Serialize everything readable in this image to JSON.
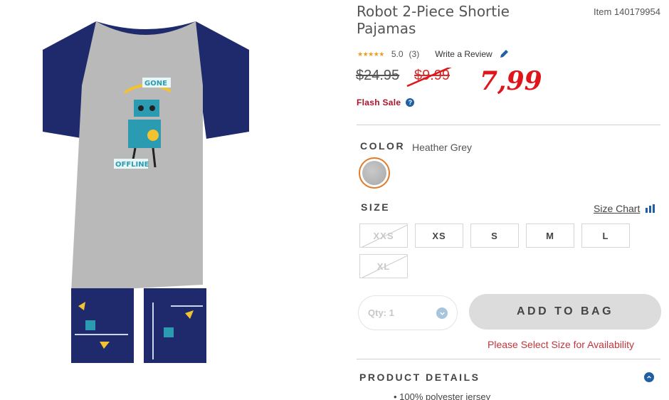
{
  "product": {
    "title": "Robot 2-Piece Shortie Pajamas",
    "item_number": "Item 140179954",
    "image_texts": [
      "GONE",
      "OFFLINE"
    ]
  },
  "rating": {
    "stars_glyph": "★★★★★",
    "value": "5.0",
    "count": "(3)",
    "write_review_label": "Write a Review"
  },
  "price": {
    "original": "$24.95",
    "sale": "$9.99",
    "handwritten_price": "7,99",
    "flash_sale_label": "Flash Sale"
  },
  "color": {
    "label": "COLOR",
    "value": "Heather Grey"
  },
  "size": {
    "label": "SIZE",
    "size_chart_label": "Size Chart",
    "options": [
      {
        "label": "XXS",
        "available": false
      },
      {
        "label": "XS",
        "available": true
      },
      {
        "label": "S",
        "available": true
      },
      {
        "label": "M",
        "available": true
      },
      {
        "label": "L",
        "available": true
      },
      {
        "label": "XL",
        "available": false
      }
    ]
  },
  "purchase": {
    "qty_label": "Qty: 1",
    "add_to_bag_label": "ADD TO BAG",
    "size_warning": "Please Select Size for Availability"
  },
  "details": {
    "label": "PRODUCT DETAILS",
    "items": [
      "100% polyester jersey"
    ]
  },
  "colors": {
    "accent_orange": "#e07b2c",
    "sale_red": "#d32f2f",
    "flash_red": "#b0122a",
    "icon_blue": "#1f5fa3",
    "handwriting_red": "#e0141b",
    "shirt_sleeve_navy": "#1e2a6b",
    "shirt_body_grey": "#b9b9b9",
    "robot_teal": "#2a9bb0"
  },
  "icons": [
    "star-icon",
    "pencil-icon",
    "help-icon",
    "swatch",
    "bar-chart-icon",
    "chevron-down-icon",
    "chevron-up-icon"
  ]
}
